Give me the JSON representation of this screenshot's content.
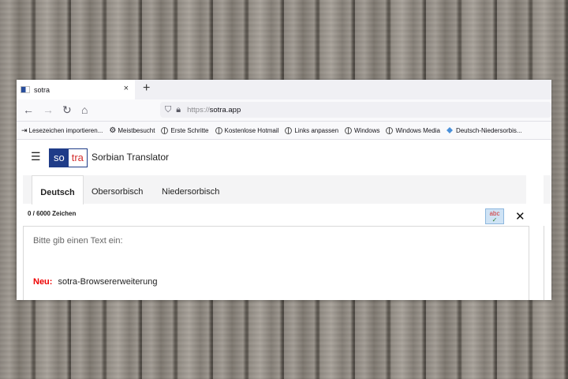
{
  "browser": {
    "tab_title": "sotra",
    "tab_close": "×",
    "new_tab": "+",
    "url_protocol": "https://",
    "url_host": "sotra.app"
  },
  "bookmarks": [
    {
      "label": "Lesezeichen importieren...",
      "icon": "import-icon"
    },
    {
      "label": "Meistbesucht",
      "icon": "gear-icon"
    },
    {
      "label": "Erste Schritte",
      "icon": "globe-icon"
    },
    {
      "label": "Kostenlose Hotmail",
      "icon": "globe-icon"
    },
    {
      "label": "Links anpassen",
      "icon": "globe-icon"
    },
    {
      "label": "Windows",
      "icon": "globe-icon"
    },
    {
      "label": "Windows Media",
      "icon": "globe-icon"
    },
    {
      "label": "Deutsch-Niedersorbis...",
      "icon": "arrow-icon"
    }
  ],
  "app": {
    "logo_so": "so",
    "logo_tra": "tra",
    "brand": "Sorbian Translator"
  },
  "translator": {
    "tabs": [
      "Deutsch",
      "Obersorbisch",
      "Niedersorbisch"
    ],
    "active_tab": "Deutsch",
    "counter": "0 / 6000 Zeichen",
    "spellcheck_label": "abc",
    "close": "✕",
    "placeholder": "Bitte gib einen Text ein:",
    "news_label": "Neu:",
    "news_text": "sotra-Browsererweiterung"
  },
  "colors": {
    "brand_blue": "#1f3c88",
    "brand_red": "#d32f2f",
    "news_red": "#e00000"
  }
}
